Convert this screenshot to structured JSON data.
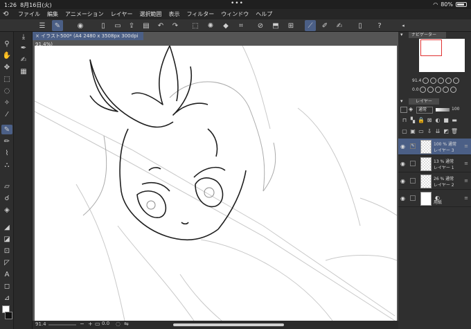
{
  "status": {
    "time": "1:26",
    "date": "8月16日(火)",
    "dots": "•••",
    "battery": "80%"
  },
  "menu": [
    "ファイル",
    "編集",
    "アニメーション",
    "レイヤー",
    "選択範囲",
    "表示",
    "フィルター",
    "ウィンドウ",
    "ヘルプ"
  ],
  "document": {
    "tab": "× イラスト500* (A4 2480 x 3508px 300dpi 91.4%)"
  },
  "bottom": {
    "zoom": "91.4",
    "angle": "0.0"
  },
  "navigator": {
    "title": "ナビゲーター",
    "zoom": "91.4",
    "angle": "0.0"
  },
  "layers_panel": {
    "title": "レイヤー",
    "blend_mode": "通常",
    "opacity": "100",
    "layers": [
      {
        "percent": "100 %",
        "mode": "通常",
        "name": "レイヤー 3",
        "selected": true,
        "paper": false
      },
      {
        "percent": "13 %",
        "mode": "通常",
        "name": "レイヤー 1",
        "selected": false,
        "paper": false
      },
      {
        "percent": "26 %",
        "mode": "通常",
        "name": "レイヤー 2",
        "selected": false,
        "paper": false
      },
      {
        "percent": "",
        "mode": "",
        "name": "用紙",
        "selected": false,
        "paper": true
      }
    ]
  },
  "icons": {
    "toolbar": [
      "menu-icon",
      "pen-icon",
      "eye-icon",
      "new-file-icon",
      "open-icon",
      "save-icon",
      "undo-icon",
      "redo-icon",
      "select-icon",
      "transform-icon",
      "fill-icon",
      "crop-icon",
      "ruler-icon",
      "brush-setting-icon",
      "gesture-icon",
      "companion-icon",
      "help-icon"
    ],
    "tools": [
      "zoom-icon",
      "hand-icon",
      "select-icon",
      "lasso-icon",
      "wand-icon",
      "eyedropper-icon",
      "pen-icon",
      "pencil-icon",
      "brush-icon",
      "airbrush-icon",
      "eraser-icon",
      "blend-icon",
      "fill-icon",
      "gradient-icon",
      "figure-icon",
      "frame-icon",
      "ruler-icon",
      "text-icon",
      "balloon-icon",
      "line-icon"
    ]
  }
}
